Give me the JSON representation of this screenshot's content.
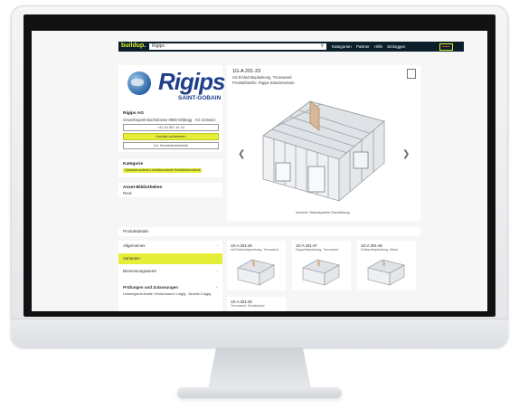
{
  "topbar": {
    "logo": "buildup",
    "logo_dot": ".",
    "search_value": "Rigips",
    "search_icon": "search-icon",
    "nav_links": [
      "Kategorien",
      "Partner",
      "Hilfe",
      "Einloggen"
    ]
  },
  "brand": {
    "name": "Rigips",
    "tagline": "SAINT-GOBAIN"
  },
  "company": {
    "name": "Rigips AG",
    "address": "Gewerbepark Bachstrasse 8888 Wildegg · AG Schweiz",
    "phone": "+41 62 887 44 44",
    "contact_btn": "Kontakt aufnehmen",
    "website_btn": "Zur Herstellerwebseite"
  },
  "category": {
    "title": "Kategorie",
    "pill": "Gipskartonwände Leichtbauwände Holzständerwände"
  },
  "assets": {
    "title": "Asset-Bibliotheken",
    "value": "Revit"
  },
  "product": {
    "code": "1G-A 201-23",
    "subtitle": "mit Einfachbeplankung, Trennwand",
    "subtitle2": "Produktfamilie: Rigips Ständerwände",
    "view_label": "Ansicht: Wandsystem Darstellung"
  },
  "details_title": "Produktdetails",
  "menu": [
    {
      "label": "Allgemeines",
      "active": false
    },
    {
      "label": "Varianten",
      "active": true
    },
    {
      "label": "Bemessungswerte",
      "active": false
    },
    {
      "label": "Prüfungen und Zulassungen",
      "active": false
    }
  ],
  "menu_extra": "Leistungsmerkmale: Einfachwand 1-lagig · Akustik 2-lagig",
  "variants": [
    {
      "code": "1G-A 201-26",
      "sub": "mit Einfachbeplankung, Trennwand"
    },
    {
      "code": "1G-A 201-27",
      "sub": "Doppelbeplankung, Trennwand"
    },
    {
      "code": "1G-A 201-28",
      "sub": "Dreifachbeplankung, Wand"
    },
    {
      "code": "1G-A 201-30",
      "sub": "Trennwand, Schallschutz"
    }
  ],
  "colors": {
    "accent": "#e6ef38",
    "nav_bg": "#0b1f2a",
    "brand_blue": "#1e3f8a"
  }
}
